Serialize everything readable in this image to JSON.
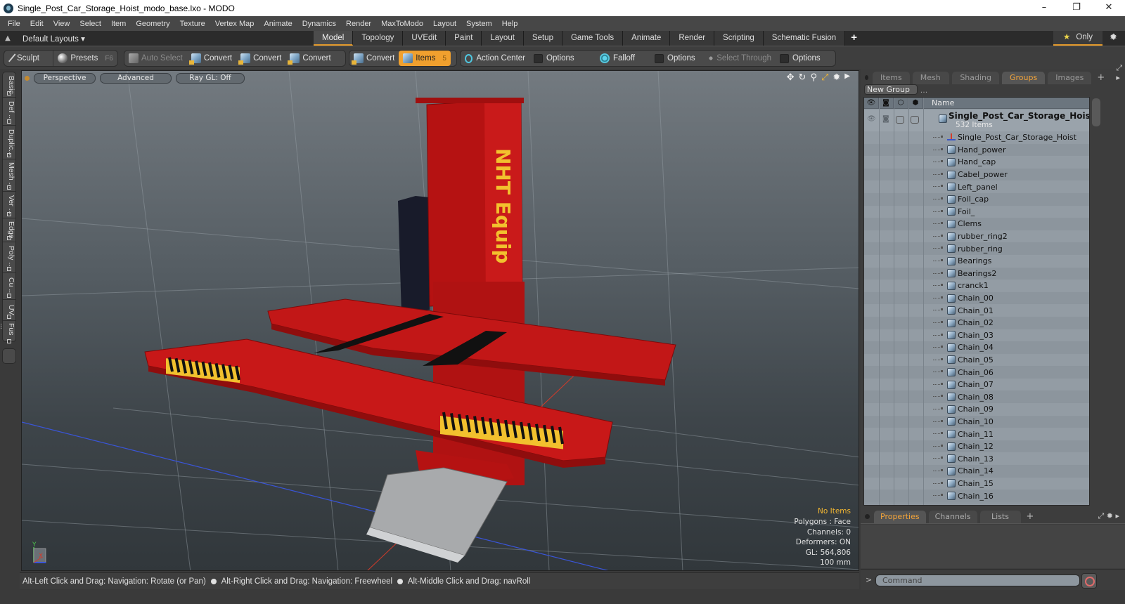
{
  "window": {
    "title": "Single_Post_Car_Storage_Hoist_modo_base.lxo - MODO",
    "controls": {
      "minimize": "–",
      "maximize": "❐",
      "close": "✕"
    }
  },
  "menu": [
    "File",
    "Edit",
    "View",
    "Select",
    "Item",
    "Geometry",
    "Texture",
    "Vertex Map",
    "Animate",
    "Dynamics",
    "Render",
    "MaxToModo",
    "Layout",
    "System",
    "Help"
  ],
  "layoutbar": {
    "layouts_label": "Default Layouts ▾",
    "tabs": [
      {
        "label": "Model",
        "active": true
      },
      {
        "label": "Topology"
      },
      {
        "label": "UVEdit"
      },
      {
        "label": "Paint"
      },
      {
        "label": "Layout"
      },
      {
        "label": "Setup"
      },
      {
        "label": "Game Tools"
      },
      {
        "label": "Animate"
      },
      {
        "label": "Render"
      },
      {
        "label": "Scripting"
      },
      {
        "label": "Schematic Fusion"
      }
    ],
    "add_tab": "+",
    "only_label": "Only",
    "star_icon": "★",
    "gear_icon": "✹"
  },
  "toolbar": {
    "sculpt": "Sculpt",
    "presets": "Presets",
    "presets_key": "F6",
    "auto_select": "Auto Select",
    "convert1": "Convert",
    "convert2": "Convert",
    "convert3": "Convert",
    "convert4": "Convert",
    "items": "Items",
    "items_key": "5",
    "action_center": "Action Center",
    "options1": "Options",
    "falloff": "Falloff",
    "options2": "Options",
    "select_through": "Select Through",
    "options3": "Options"
  },
  "left_tabs": [
    "Basic",
    "Def ...",
    "Duplic...",
    "Mesh ...",
    "Ver ...",
    "Edge",
    "Poly ...",
    "Cu ...",
    "UV",
    "Fus ..."
  ],
  "viewport": {
    "view_mode": "Perspective",
    "shading": "Advanced",
    "raygl": "Ray GL: Off",
    "nav_icons": [
      "move-icon",
      "rotate-icon",
      "zoom-icon",
      "fit-icon",
      "gear-icon",
      "arrow-icon"
    ],
    "model_text": "NHT Equip",
    "info": {
      "selection": "No Items",
      "polygons": "Polygons : Face",
      "channels": "Channels: 0",
      "deformers": "Deformers: ON",
      "gl": "GL: 564,806",
      "unit": "100 mm"
    },
    "axis": {
      "y": "Y",
      "x": "X"
    }
  },
  "statusbar": {
    "hint1": "Alt-Left Click and Drag: Navigation: Rotate (or Pan)",
    "hint2": "Alt-Right Click and Drag: Navigation: Freewheel",
    "hint3": "Alt-Middle Click and Drag: navRoll"
  },
  "right_panel": {
    "tabs": [
      {
        "label": "Items"
      },
      {
        "label": "Mesh ..."
      },
      {
        "label": "Shading"
      },
      {
        "label": "Groups",
        "active": true
      },
      {
        "label": "Images"
      }
    ],
    "add_tab": "+",
    "new_group": "New Group",
    "columns": {
      "name": "Name"
    },
    "root": {
      "name": "Single_Post_Car_Storage_Hoist (...",
      "count": "532 Items"
    },
    "items": [
      {
        "name": "Single_Post_Car_Storage_Hoist",
        "type": "locator"
      },
      {
        "name": "Hand_power",
        "type": "mesh"
      },
      {
        "name": "Hand_cap",
        "type": "mesh"
      },
      {
        "name": "Cabel_power",
        "type": "mesh"
      },
      {
        "name": "Left_panel",
        "type": "mesh"
      },
      {
        "name": "Foil_cap",
        "type": "mesh"
      },
      {
        "name": "Foil_",
        "type": "mesh"
      },
      {
        "name": "Clems",
        "type": "mesh"
      },
      {
        "name": "rubber_ring2",
        "type": "mesh"
      },
      {
        "name": "rubber_ring",
        "type": "mesh"
      },
      {
        "name": "Bearings",
        "type": "mesh"
      },
      {
        "name": "Bearings2",
        "type": "mesh"
      },
      {
        "name": "cranck1",
        "type": "mesh"
      },
      {
        "name": "Chain_00",
        "type": "mesh"
      },
      {
        "name": "Chain_01",
        "type": "mesh"
      },
      {
        "name": "Chain_02",
        "type": "mesh"
      },
      {
        "name": "Chain_03",
        "type": "mesh"
      },
      {
        "name": "Chain_04",
        "type": "mesh"
      },
      {
        "name": "Chain_05",
        "type": "mesh"
      },
      {
        "name": "Chain_06",
        "type": "mesh"
      },
      {
        "name": "Chain_07",
        "type": "mesh"
      },
      {
        "name": "Chain_08",
        "type": "mesh"
      },
      {
        "name": "Chain_09",
        "type": "mesh"
      },
      {
        "name": "Chain_10",
        "type": "mesh"
      },
      {
        "name": "Chain_11",
        "type": "mesh"
      },
      {
        "name": "Chain_12",
        "type": "mesh"
      },
      {
        "name": "Chain_13",
        "type": "mesh"
      },
      {
        "name": "Chain_14",
        "type": "mesh"
      },
      {
        "name": "Chain_15",
        "type": "mesh"
      },
      {
        "name": "Chain_16",
        "type": "mesh"
      }
    ],
    "bottom_tabs": [
      {
        "label": "Properties",
        "active": true
      },
      {
        "label": "Channels"
      },
      {
        "label": "Lists"
      }
    ],
    "command_prompt": ">",
    "command_placeholder": "Command"
  },
  "colors": {
    "accent": "#f0a02e",
    "hoist_red": "#c41414",
    "stripe_yellow": "#f2c12e",
    "tree_bg": "#8e979f"
  }
}
